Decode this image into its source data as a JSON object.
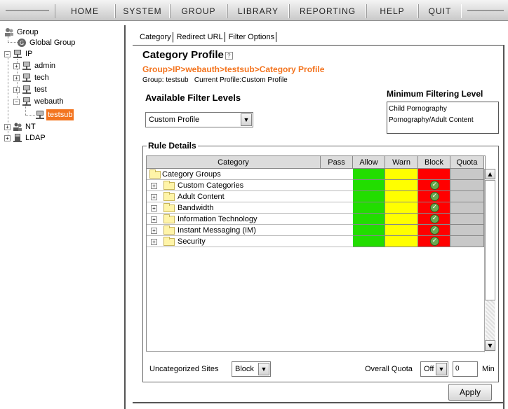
{
  "nav": {
    "items": [
      "HOME",
      "SYSTEM",
      "GROUP",
      "LIBRARY",
      "REPORTING",
      "HELP",
      "QUIT"
    ]
  },
  "tree": {
    "root": "Group",
    "global_group": "Global Group",
    "ip": "IP",
    "admin": "admin",
    "tech": "tech",
    "test": "test",
    "webauth": "webauth",
    "testsub": "testsub",
    "nt": "NT",
    "ldap": "LDAP"
  },
  "tabs": [
    "Category",
    "Redirect URL",
    "Filter Options"
  ],
  "page": {
    "title": "Category Profile",
    "help_icon": "help-icon",
    "breadcrumb": "Group>IP>webauth>testsub>Category Profile",
    "group_info": "Group: testsub   Current Profile:Custom Profile"
  },
  "filter_levels": {
    "title": "Available Filter Levels",
    "selected": "Custom Profile"
  },
  "min_filter": {
    "title": "Minimum Filtering Level",
    "items": [
      "Child Pornography",
      "Pornography/Adult Content"
    ]
  },
  "rules": {
    "title": "Rule Details",
    "headers": [
      "Category",
      "Pass",
      "Allow",
      "Warn",
      "Block",
      "Quota"
    ],
    "group_row": "Category Groups",
    "rows": [
      "Custom Categories",
      "Adult Content",
      "Bandwidth",
      "Information Technology",
      "Instant Messaging (IM)",
      "Security"
    ],
    "colors": {
      "allow": "#22dd00",
      "warn": "#ffff00",
      "block": "#ff0000",
      "quota": "#c8c8c8"
    }
  },
  "footer": {
    "uncategorized_label": "Uncategorized Sites",
    "uncategorized_value": "Block",
    "quota_label": "Overall Quota",
    "quota_value": "Off",
    "quota_minutes": "0",
    "min_label": "Min",
    "apply": "Apply"
  }
}
